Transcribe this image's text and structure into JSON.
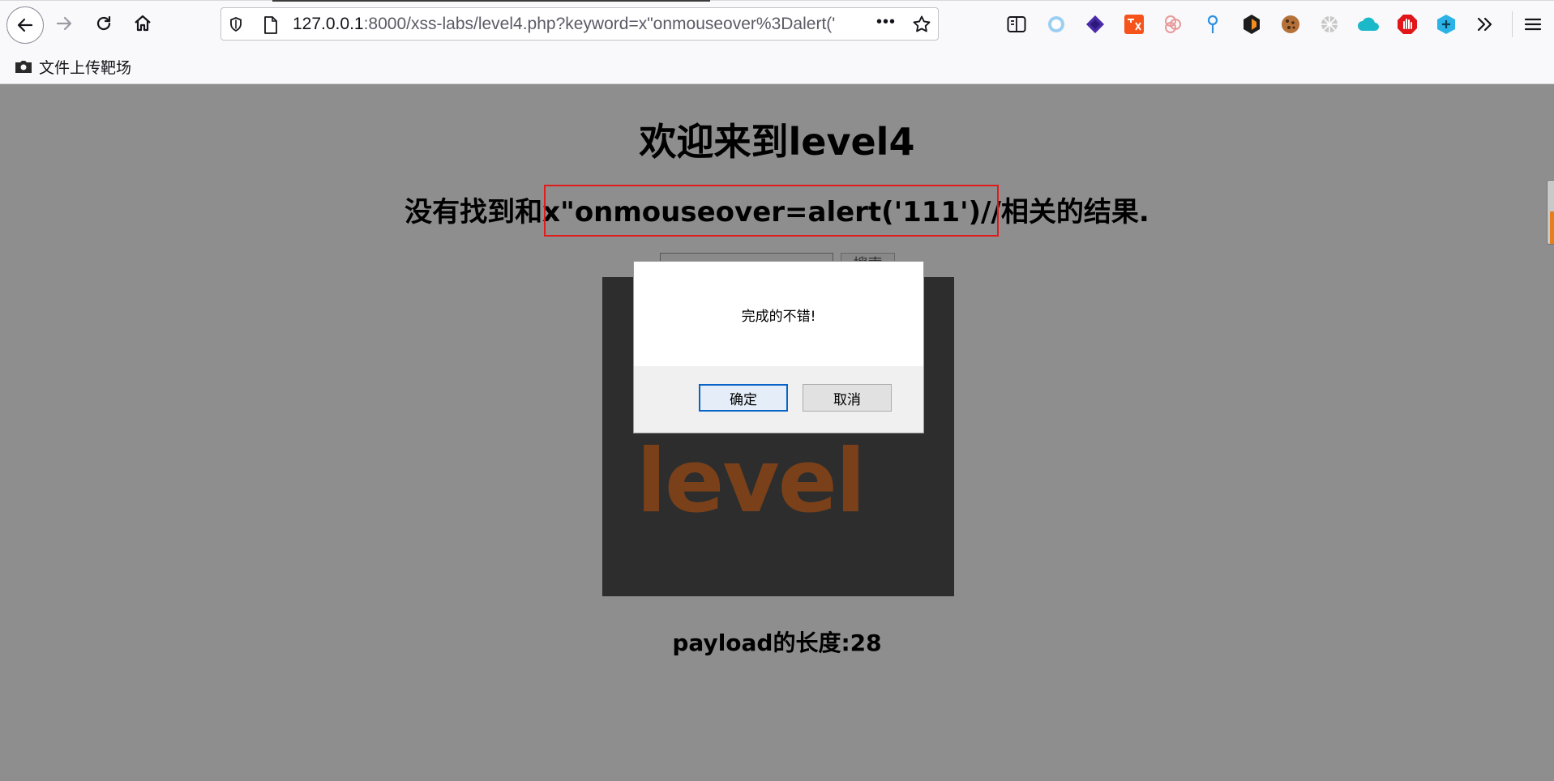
{
  "browser": {
    "url_host": "127.0.0.1",
    "url_rest": ":8000/xss-labs/level4.php?keyword=x\"onmouseover%3Dalert('",
    "more_label": "•••",
    "bookmark_label": "文件上传靶场"
  },
  "page": {
    "heading": "欢迎来到level4",
    "result_prefix": "没有找到和",
    "result_payload": "x\"onmouseover=alert('111')//",
    "result_suffix": "相关的结果.",
    "search_button": "搜索",
    "image_text": "level",
    "payload_length": "payload的长度:28"
  },
  "dialog": {
    "message": "完成的不错!",
    "ok": "确定",
    "cancel": "取消"
  },
  "colors": {
    "highlight_box": "#e01b1b",
    "page_background": "#8e8e8e",
    "image_background": "#2d2d2d"
  }
}
